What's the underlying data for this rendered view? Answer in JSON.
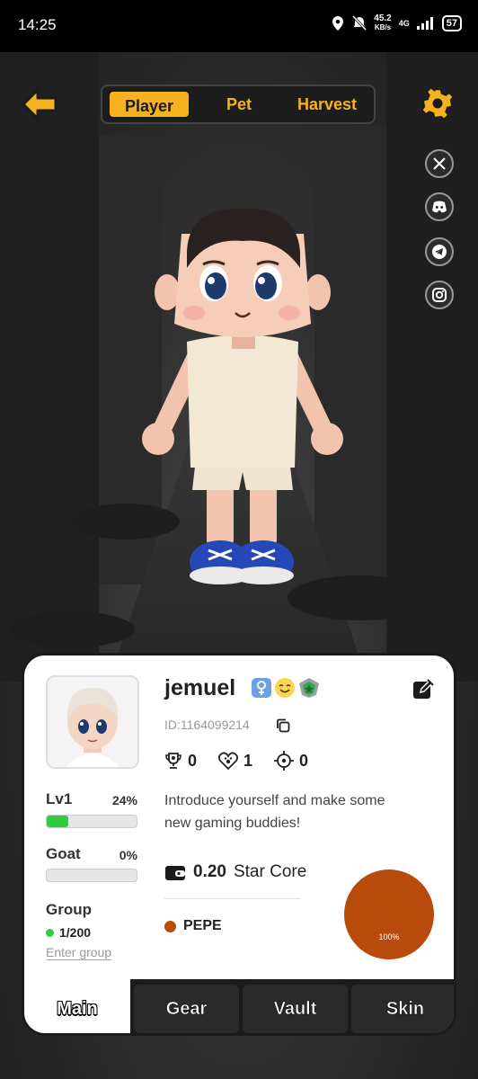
{
  "status_bar": {
    "time": "14:25",
    "net_speed_value": "45.2",
    "net_speed_unit": "KB/s",
    "network": "4G",
    "battery": "57"
  },
  "nav": {
    "tabs": [
      {
        "label": "Player",
        "active": true
      },
      {
        "label": "Pet",
        "active": false
      },
      {
        "label": "Harvest",
        "active": false
      }
    ],
    "back_icon": "arrow-left-icon",
    "settings_icon": "gear-icon"
  },
  "social": [
    "x-icon",
    "discord-icon",
    "telegram-icon",
    "instagram-icon"
  ],
  "profile": {
    "username": "jemuel",
    "user_id": "ID:1164099214",
    "stats": [
      {
        "icon": "trophy-icon",
        "value": "0"
      },
      {
        "icon": "paw-heart-icon",
        "value": "1"
      },
      {
        "icon": "crosshair-icon",
        "value": "0"
      }
    ],
    "intro": "Introduce yourself and make some new gaming buddies!",
    "level": {
      "label": "Lv1",
      "percent": "24%",
      "progress": 0.24
    },
    "goat": {
      "label": "Goat",
      "percent": "0%",
      "progress": 0
    },
    "group": {
      "label": "Group",
      "count": "1/200",
      "enter_label": "Enter group"
    },
    "wallet": {
      "amount": "0.20",
      "currency": "Star Core"
    }
  },
  "chart_data": {
    "type": "pie",
    "slices": [
      {
        "label": "PEPE",
        "value": 100,
        "percent_label": "100%"
      }
    ],
    "legend_position": "left",
    "colors": [
      "#b84b0c"
    ]
  },
  "bottom_tabs": [
    {
      "label": "Main",
      "active": true
    },
    {
      "label": "Gear",
      "active": false
    },
    {
      "label": "Vault",
      "active": false
    },
    {
      "label": "Skin",
      "active": false
    }
  ],
  "colors": {
    "accent": "#f6b21e",
    "pepe": "#b84b0c",
    "progress": "#2ecc40"
  }
}
